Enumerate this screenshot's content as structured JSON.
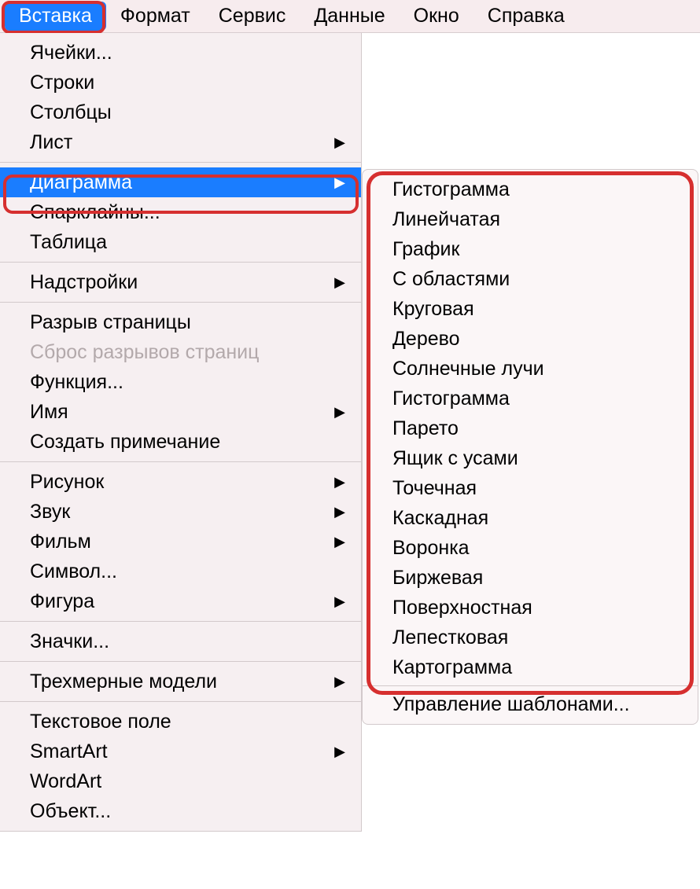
{
  "menubar": {
    "items": [
      {
        "label": "Вставка",
        "active": true
      },
      {
        "label": "Формат"
      },
      {
        "label": "Сервис"
      },
      {
        "label": "Данные"
      },
      {
        "label": "Окно"
      },
      {
        "label": "Справка"
      }
    ]
  },
  "dropdown": {
    "groups": [
      [
        {
          "label": "Ячейки..."
        },
        {
          "label": "Строки"
        },
        {
          "label": "Столбцы"
        },
        {
          "label": "Лист",
          "submenu": true
        }
      ],
      [
        {
          "label": "Диаграмма",
          "submenu": true,
          "hover": true
        },
        {
          "label": "Спарклайны..."
        },
        {
          "label": "Таблица"
        }
      ],
      [
        {
          "label": "Надстройки",
          "submenu": true
        }
      ],
      [
        {
          "label": "Разрыв страницы"
        },
        {
          "label": "Сброс разрывов страниц",
          "disabled": true
        },
        {
          "label": "Функция..."
        },
        {
          "label": "Имя",
          "submenu": true
        },
        {
          "label": "Создать примечание"
        }
      ],
      [
        {
          "label": "Рисунок",
          "submenu": true
        },
        {
          "label": "Звук",
          "submenu": true
        },
        {
          "label": "Фильм",
          "submenu": true
        },
        {
          "label": "Символ..."
        },
        {
          "label": "Фигура",
          "submenu": true
        }
      ],
      [
        {
          "label": "Значки..."
        }
      ],
      [
        {
          "label": "Трехмерные модели",
          "submenu": true
        }
      ],
      [
        {
          "label": "Текстовое поле"
        },
        {
          "label": "SmartArt",
          "submenu": true
        },
        {
          "label": "WordArt"
        },
        {
          "label": "Объект..."
        }
      ]
    ]
  },
  "submenu": {
    "items": [
      "Гистограмма",
      "Линейчатая",
      "График",
      "С областями",
      "Круговая",
      "Дерево",
      "Солнечные лучи",
      "Гистограмма",
      "Парето",
      "Ящик с усами",
      "Точечная",
      "Каскадная",
      "Воронка",
      "Биржевая",
      "Поверхностная",
      "Лепестковая",
      "Картограмма"
    ],
    "footer": "Управление шаблонами..."
  }
}
